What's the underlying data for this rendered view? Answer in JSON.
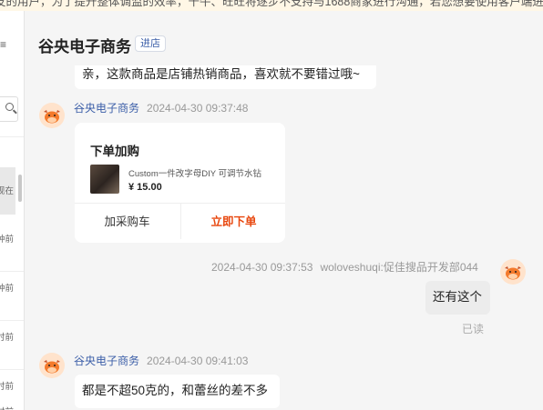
{
  "notice": {
    "text": "友的用户，为了提升整体调监的效率，千牛、旺旺将逐步不支持与1688商家进行沟通，若您想要使用客户端进行沟通"
  },
  "sidebar": {
    "times": [
      "现在",
      "钟前",
      "钟前",
      "时前",
      "时前",
      "时前"
    ]
  },
  "header": {
    "title": "谷央电子商务",
    "badge": "进店"
  },
  "messages": {
    "m1": {
      "text": "亲，这款商品是店铺热销商品，喜欢就不要错过哦~"
    },
    "m2": {
      "sender": "谷央电子商务",
      "time": "2024-04-30 09:37:48",
      "card": {
        "title": "下单加购",
        "product_name": "Custom一件改字母DIY 可调节水钻",
        "price": "¥ 15.00",
        "cart_label": "加采购车",
        "buy_label": "立即下单"
      }
    },
    "m3": {
      "time": "2024-04-30 09:37:53",
      "sender": "woloveshuqi:促佳搜品开发部044",
      "text": "还有这个",
      "status": "已读"
    },
    "m4": {
      "sender": "谷央电子商务",
      "time": "2024-04-30 09:41:03",
      "text": "都是不超50克的，和蕾丝的差不多"
    }
  },
  "colors": {
    "accent_link": "#3b5ea8",
    "buy_button": "#e8470e",
    "background": "#f5f5f5"
  }
}
